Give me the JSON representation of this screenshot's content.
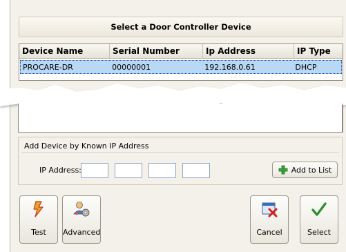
{
  "dialog": {
    "title": "Select a Door Controller Device"
  },
  "grid": {
    "columns": [
      "Device Name",
      "Serial Number",
      "Ip Address",
      "IP Type"
    ],
    "rows": [
      {
        "device_name": "PROCARE-DR",
        "serial_number": "00000001",
        "ip_address": "192.168.0.61",
        "ip_type": "DHCP"
      }
    ]
  },
  "add_device": {
    "group_label": "Add Device by Known IP Address",
    "ip_label": "IP Address:",
    "octets": [
      "",
      "",
      "",
      ""
    ],
    "add_button_label": "Add to List"
  },
  "buttons": {
    "test": "Test",
    "advanced": "Advanced",
    "cancel": "Cancel",
    "select": "Select"
  },
  "colors": {
    "selected_row": "#b8d8f5",
    "dialog_bg": "#f3f1ea"
  }
}
